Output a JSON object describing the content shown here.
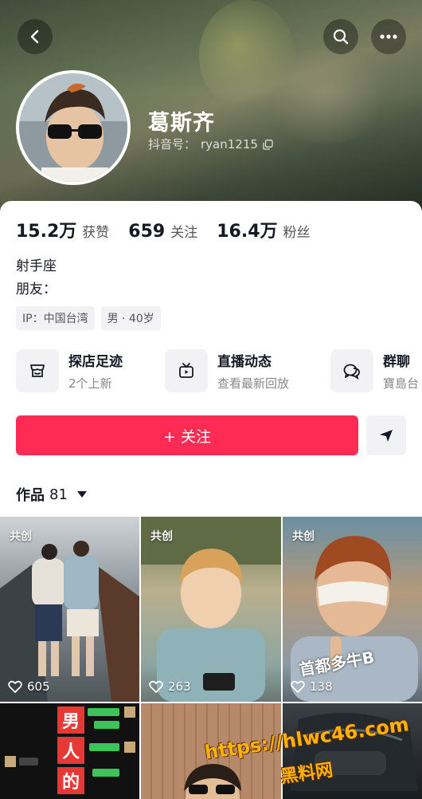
{
  "profile": {
    "nickname": "葛斯齐",
    "id_label": "抖音号：",
    "id_value": "ryan1215"
  },
  "stats": [
    {
      "value": "15.2万",
      "label": "获赞"
    },
    {
      "value": "659",
      "label": "关注"
    },
    {
      "value": "16.4万",
      "label": "粉丝"
    }
  ],
  "bio": {
    "line1": "射手座",
    "line2": "朋友："
  },
  "tags": [
    "IP：中国台湾",
    "男 · 40岁"
  ],
  "features": [
    {
      "title": "探店足迹",
      "subtitle": "2个上新",
      "icon": "shop-icon"
    },
    {
      "title": "直播动态",
      "subtitle": "查看最新回放",
      "icon": "tv-icon"
    },
    {
      "title": "群聊",
      "subtitle": "寶島台",
      "icon": "chat-icon"
    }
  ],
  "actions": {
    "follow_label": "+ 关注"
  },
  "works": {
    "label": "作品",
    "count": "81"
  },
  "videos": [
    {
      "badge": "共创",
      "likes": "605"
    },
    {
      "badge": "共创",
      "likes": "263"
    },
    {
      "badge": "共创",
      "likes": "138",
      "overlay": "首都多牛B"
    },
    {
      "overlay_chars": [
        "男",
        "人",
        "的"
      ]
    },
    {},
    {}
  ],
  "watermark": {
    "line1": "https://hlwc46.com",
    "line2": "黑料网"
  },
  "colors": {
    "accent": "#fe2c55",
    "chip_bg": "#f2f2f4"
  }
}
